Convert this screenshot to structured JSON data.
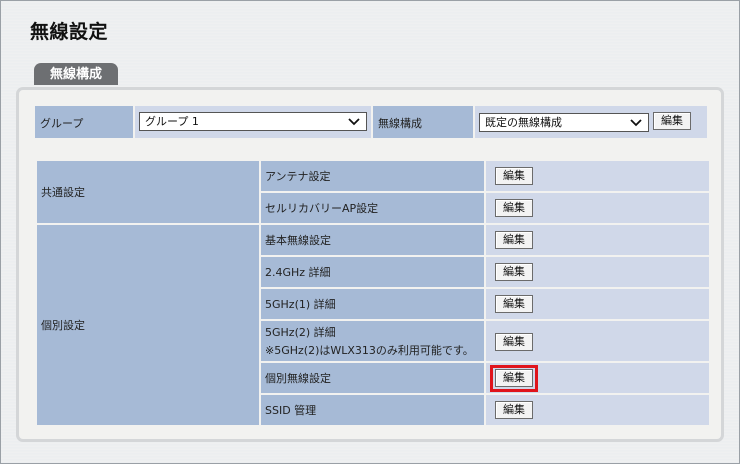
{
  "page": {
    "title": "無線設定",
    "tab": "無線構成"
  },
  "top_row": {
    "group_label": "グループ",
    "group_value": "グループ 1",
    "config_label": "無線構成",
    "config_value": "既定の無線構成",
    "edit_label": "編集"
  },
  "sections": [
    {
      "label": "共通設定",
      "items": [
        {
          "name": "アンテナ設定",
          "button": "編集"
        },
        {
          "name": "セルリカバリーAP設定",
          "button": "編集"
        }
      ]
    },
    {
      "label": "個別設定",
      "items": [
        {
          "name": "基本無線設定",
          "button": "編集"
        },
        {
          "name": "2.4GHz 詳細",
          "button": "編集"
        },
        {
          "name": "5GHz(1) 詳細",
          "button": "編集"
        },
        {
          "name": "5GHz(2) 詳細",
          "note": "※5GHz(2)はWLX313のみ利用可能です。",
          "button": "編集"
        },
        {
          "name": "個別無線設定",
          "button": "編集",
          "highlighted": true
        },
        {
          "name": "SSID 管理",
          "button": "編集"
        }
      ]
    }
  ],
  "colors": {
    "header_cell": "#a6bad6",
    "value_cell": "#d0d8e9",
    "highlight": "#e0141b",
    "tab": "#6d6f72"
  }
}
